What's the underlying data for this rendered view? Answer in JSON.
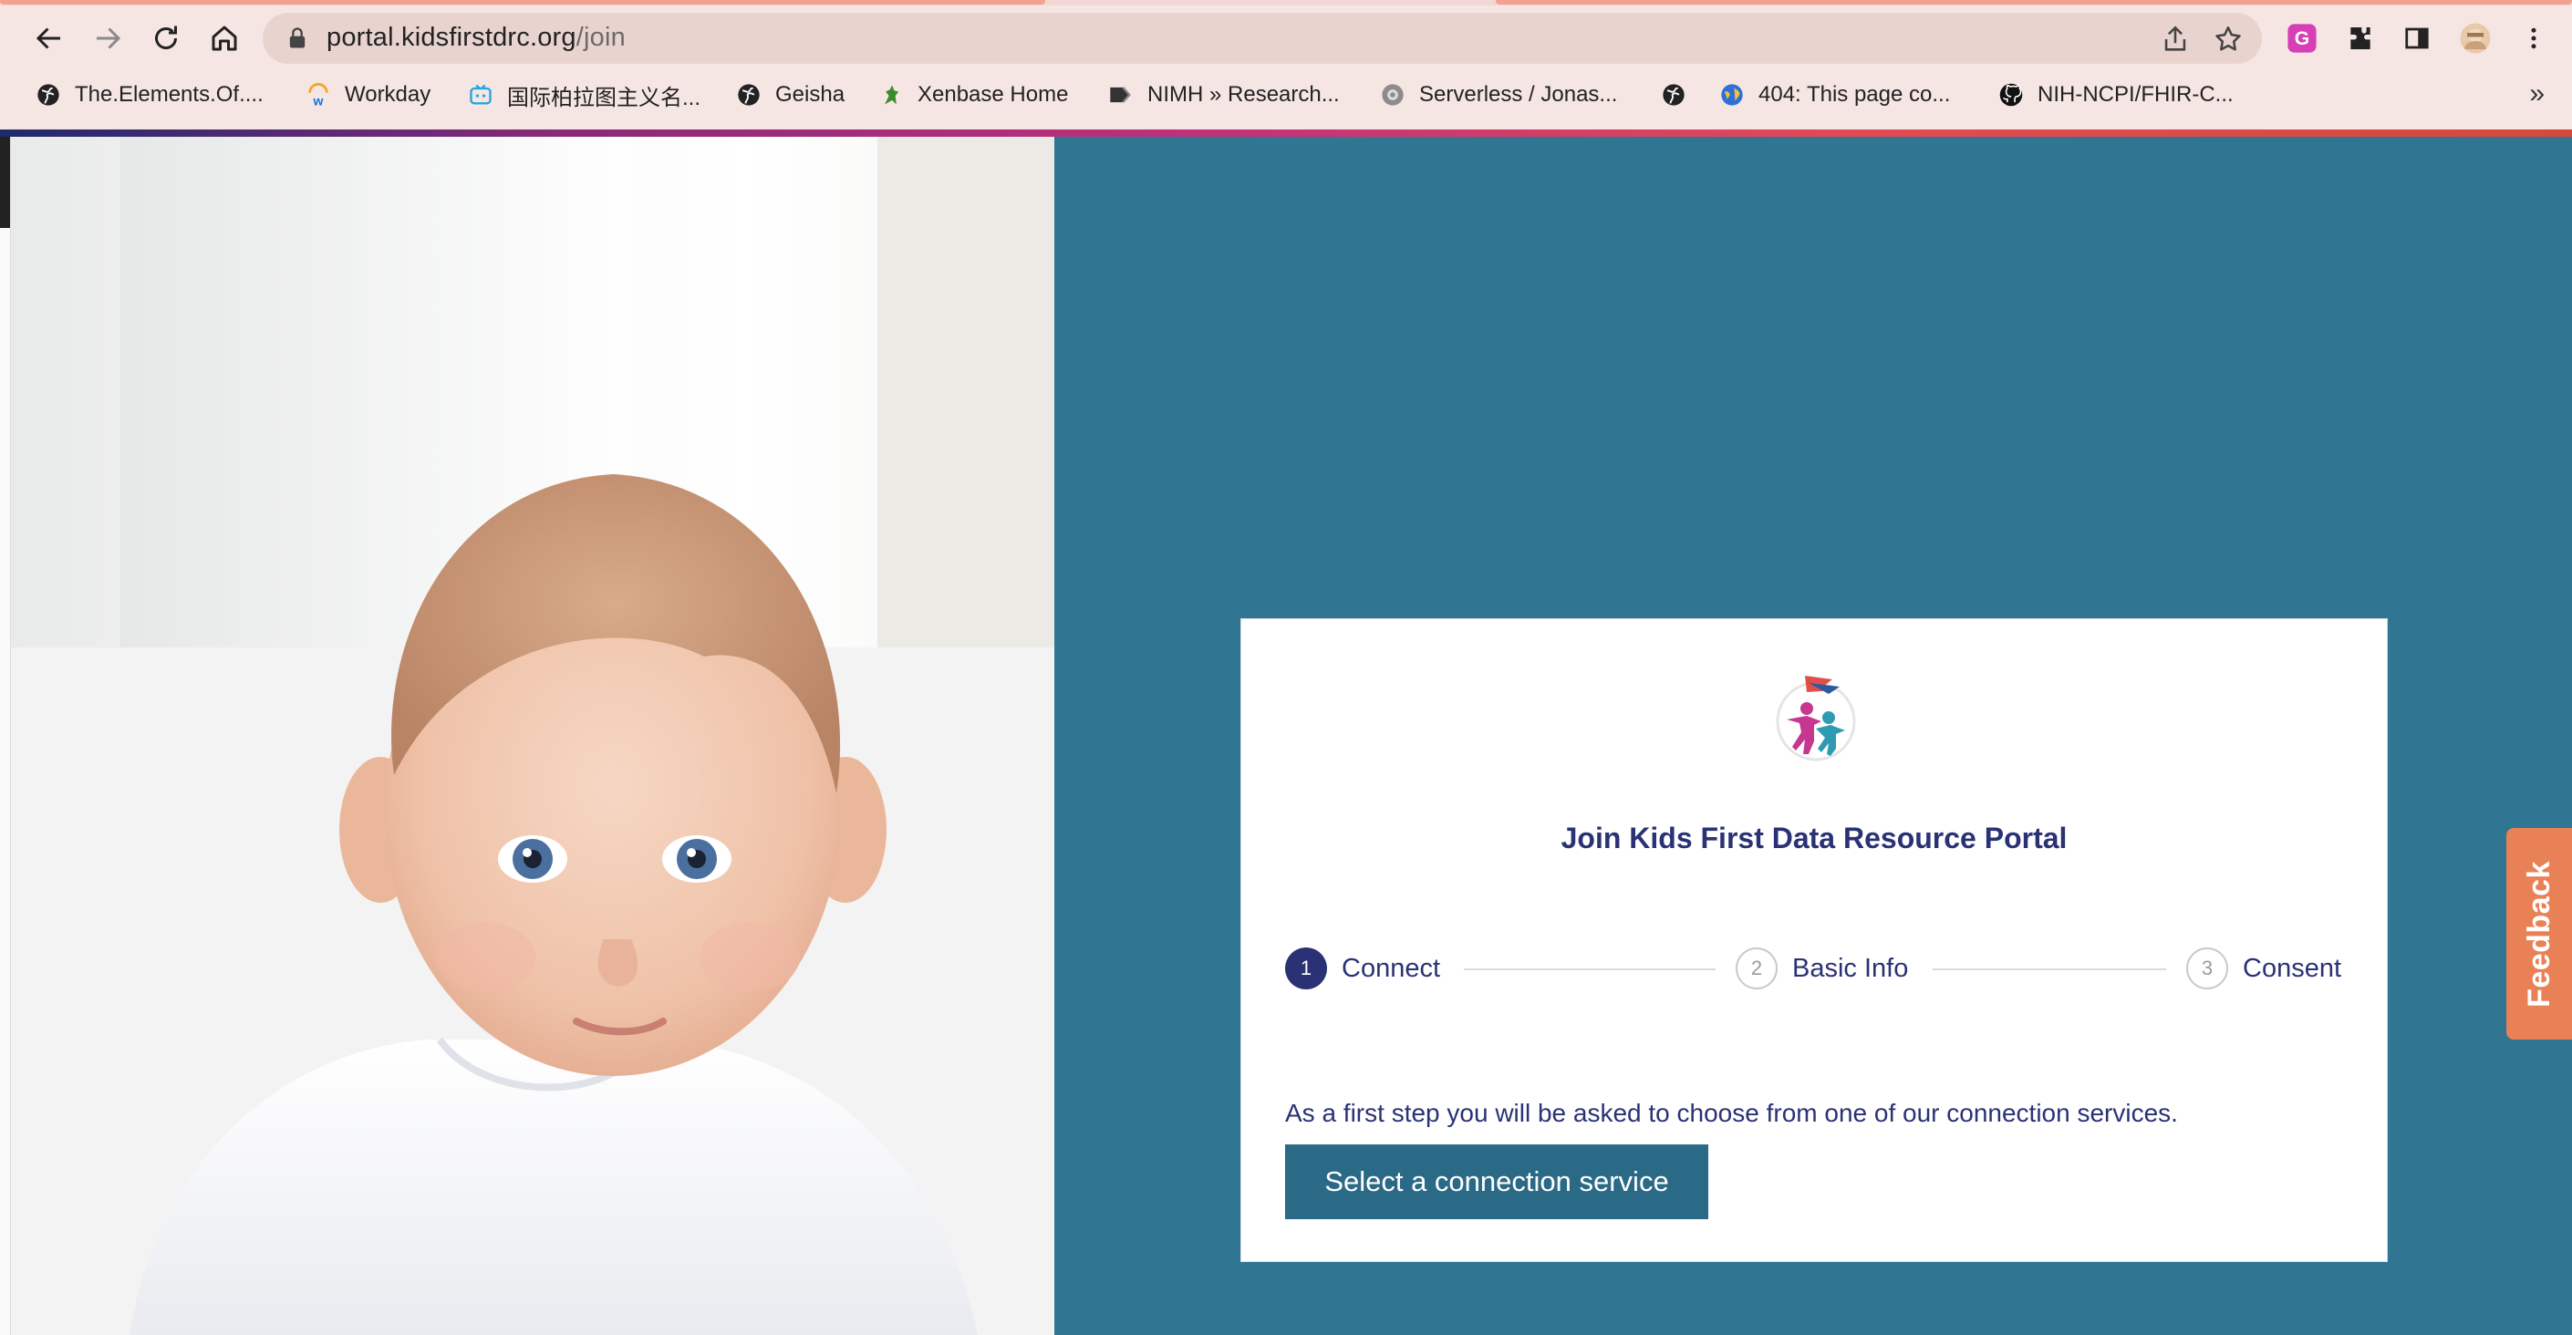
{
  "browser": {
    "url_host": "portal.kidsfirstdrc.org",
    "url_path": "/join",
    "bookmarks": [
      {
        "label": "The.Elements.Of....",
        "icon": "globe-icon"
      },
      {
        "label": "Workday",
        "icon": "workday-icon"
      },
      {
        "label": "国际柏拉图主义名...",
        "icon": "bilibili-icon"
      },
      {
        "label": "Geisha",
        "icon": "globe-icon"
      },
      {
        "label": "Xenbase Home",
        "icon": "frog-icon"
      },
      {
        "label": "NIMH » Research...",
        "icon": "nimh-icon"
      },
      {
        "label": "Serverless / Jonas...",
        "icon": "serverless-icon"
      },
      {
        "label": "",
        "icon": "globe-icon"
      },
      {
        "label": "404: This page co...",
        "icon": "earth-icon"
      },
      {
        "label": "NIH-NCPI/FHIR-C...",
        "icon": "github-icon"
      }
    ],
    "more_bookmarks": "»"
  },
  "page": {
    "title": "Join Kids First Data Resource Portal",
    "steps": [
      {
        "number": "1",
        "label": "Connect",
        "state": "active"
      },
      {
        "number": "2",
        "label": "Basic Info",
        "state": "inactive"
      },
      {
        "number": "3",
        "label": "Consent",
        "state": "inactive"
      }
    ],
    "description": "As a first step you will be asked to choose from one of our connection services.",
    "cta_label": "Select a connection service",
    "feedback_label": "Feedback"
  },
  "colors": {
    "panel_bg": "#307592",
    "title_navy": "#2a3275",
    "cta_bg": "#2b6a86",
    "feedback_bg": "#e98157"
  }
}
